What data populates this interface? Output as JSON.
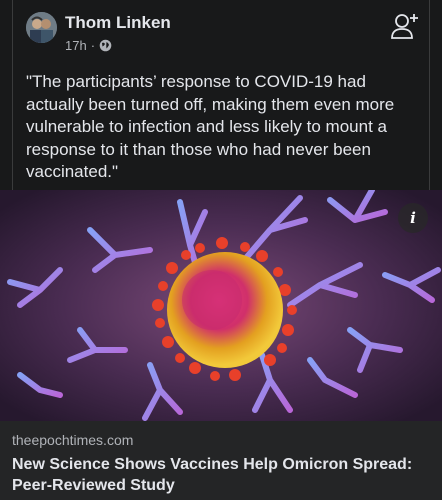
{
  "post": {
    "author": "Thom Linken",
    "time": "17h",
    "separator": "·",
    "audience_icon": "globe-icon",
    "action_icon": "add-friend-icon",
    "text": "\"The participants’ response to COVID-19 had actually been turned off, making them even more vulnerable to infection and less likely to mount a response to it than those who had never been vaccinated.\""
  },
  "link": {
    "image_subject": "coronavirus-with-antibodies-illustration",
    "info_glyph": "i",
    "domain": "theepochtimes.com",
    "title": "New Science Shows Vaccines Help Omicron Spread: Peer-Reviewed Study"
  },
  "colors": {
    "background": "#18191a",
    "footer": "#242526",
    "primary_text": "#e4e6eb",
    "secondary_text": "#b0b3b8"
  }
}
